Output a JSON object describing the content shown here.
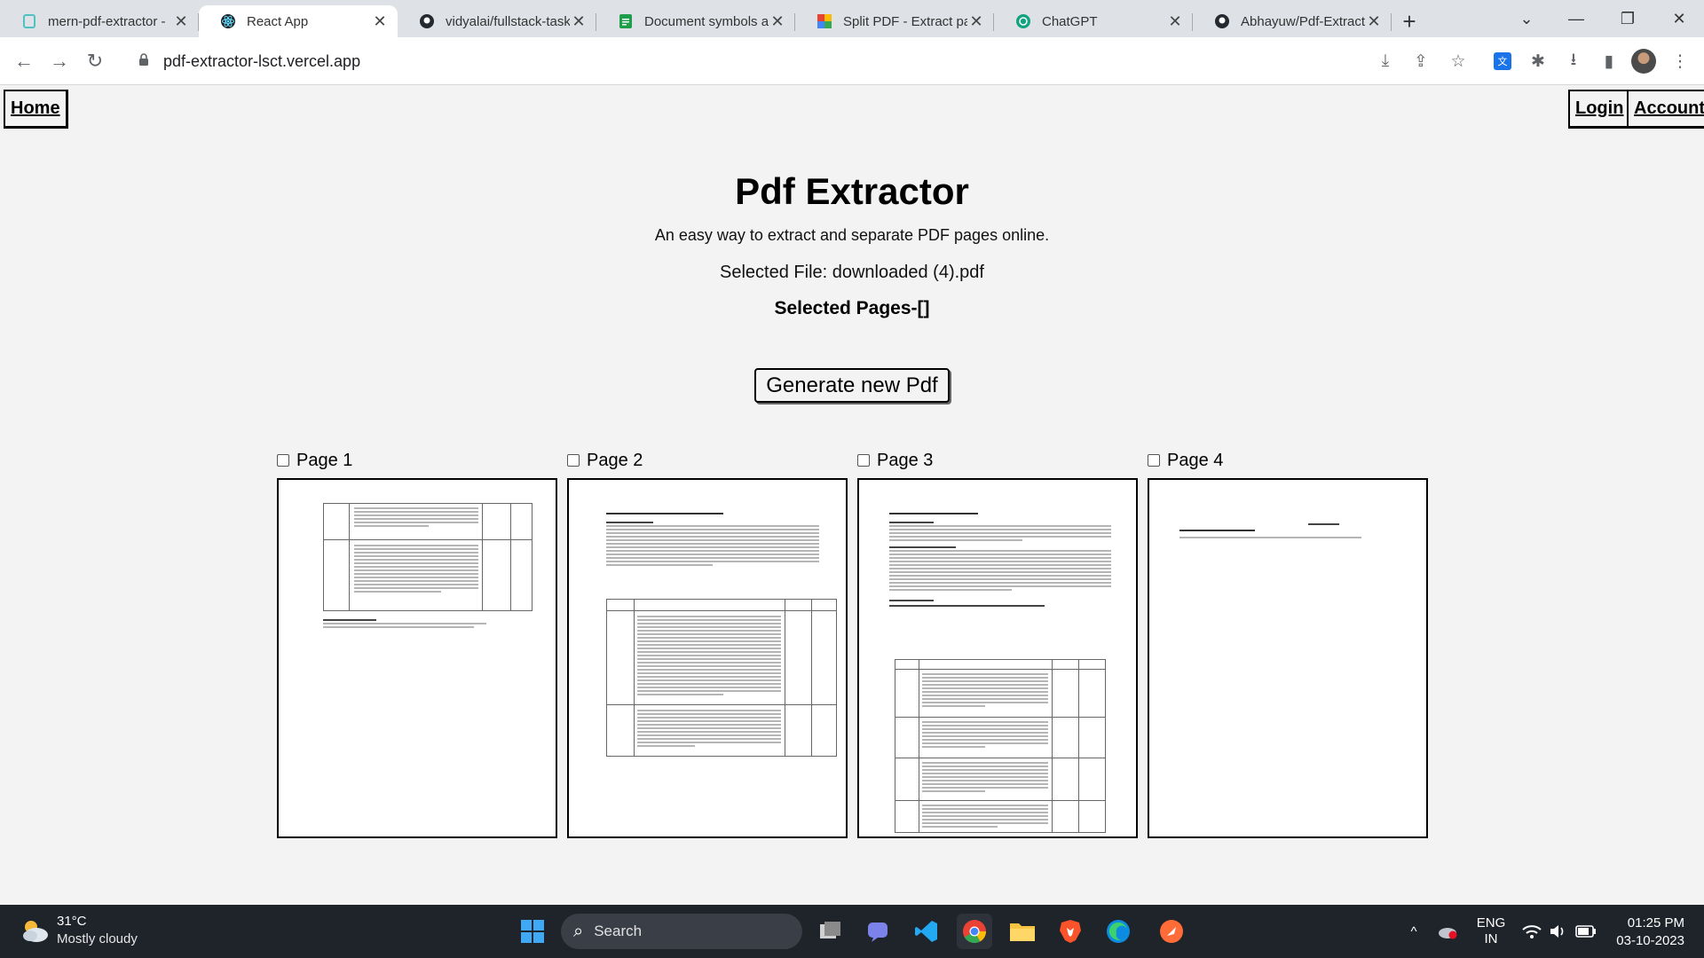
{
  "browser": {
    "tabs": [
      {
        "title": "mern-pdf-extractor -",
        "icon": "page-icon",
        "icon_color": "#4fc3c3"
      },
      {
        "title": "React App",
        "icon": "react-icon",
        "icon_color": "#61dafb"
      },
      {
        "title": "vidyalai/fullstack-task",
        "icon": "github-icon",
        "icon_color": "#24292f"
      },
      {
        "title": "Document symbols a",
        "icon": "docs-icon",
        "icon_color": "#1e9e4a"
      },
      {
        "title": "Split PDF - Extract pa",
        "icon": "tiles-icon",
        "icon_color": "#e94235"
      },
      {
        "title": "ChatGPT",
        "icon": "chatgpt-icon",
        "icon_color": "#10a37f"
      },
      {
        "title": "Abhayuw/Pdf-Extract",
        "icon": "github-icon",
        "icon_color": "#24292f"
      }
    ],
    "url": "pdf-extractor-lsct.vercel.app"
  },
  "nav": {
    "home": "Home",
    "login": "Login",
    "account": "Account"
  },
  "main": {
    "title": "Pdf Extractor",
    "subtitle": "An easy way to extract and separate PDF pages online.",
    "selected_file": "Selected File: downloaded (4).pdf",
    "selected_pages": "Selected Pages-[]",
    "generate_button": "Generate new Pdf"
  },
  "pages": [
    {
      "label": "Page 1",
      "checked": false
    },
    {
      "label": "Page 2",
      "checked": false
    },
    {
      "label": "Page 3",
      "checked": false
    },
    {
      "label": "Page 4",
      "checked": false
    }
  ],
  "taskbar": {
    "weather_temp": "31°C",
    "weather_desc": "Mostly cloudy",
    "search_label": "Search",
    "lang": "ENG",
    "region": "IN",
    "time": "01:25 PM",
    "date": "03-10-2023"
  }
}
